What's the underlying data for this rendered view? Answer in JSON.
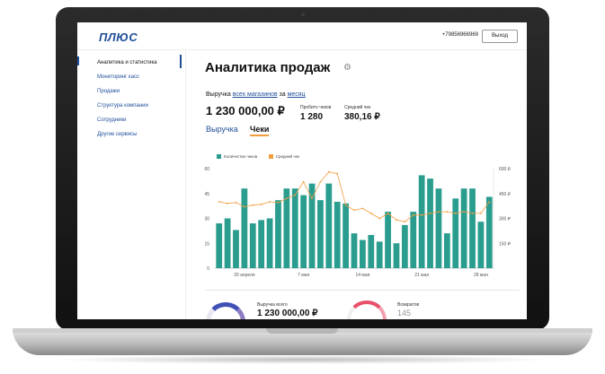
{
  "header": {
    "logo": "ПЛЮС",
    "phone": "+79856966969",
    "logout_label": "Выход"
  },
  "sidebar": {
    "items": [
      {
        "label": "Аналитика и статистика",
        "active": true
      },
      {
        "label": "Мониторинг касс",
        "active": false
      },
      {
        "label": "Продажи",
        "active": false
      },
      {
        "label": "Структура компании",
        "active": false
      },
      {
        "label": "Сотрудники",
        "active": false
      },
      {
        "label": "Другие сервисы",
        "active": false
      }
    ]
  },
  "main": {
    "title": "Аналитика продаж",
    "revenue_prefix": "Выручка",
    "revenue_link1": "всех магазинов",
    "revenue_mid": "за",
    "revenue_link2": "месяц",
    "revenue_total": "1 230 000,00 ₽",
    "stat1_label": "Пробито чеков",
    "stat1_value": "1 280",
    "stat2_label": "Средний чек",
    "stat2_value": "380,16 ₽",
    "tabs": [
      "Выручка",
      "Чеки"
    ],
    "active_tab": "Чеки"
  },
  "chart_data": {
    "type": "bar",
    "series": [
      {
        "name": "Количество чеков",
        "type": "bar",
        "axis": "left",
        "color": "#2a9d8f",
        "values": [
          27,
          30,
          23,
          48,
          27,
          29,
          30,
          41,
          48,
          48,
          44,
          51,
          41,
          51,
          40,
          39,
          21,
          17,
          20,
          16,
          34,
          15,
          26,
          34,
          56,
          54,
          48,
          21,
          42,
          48,
          48,
          28,
          43
        ]
      },
      {
        "name": "Средний чек",
        "type": "line",
        "axis": "right",
        "color": "#f39c3c",
        "values": [
          400,
          390,
          395,
          370,
          380,
          385,
          400,
          395,
          420,
          440,
          520,
          420,
          520,
          580,
          570,
          380,
          350,
          360,
          330,
          300,
          330,
          290,
          280,
          320,
          320,
          330,
          340,
          340,
          330,
          340,
          330,
          330,
          400
        ]
      }
    ],
    "x_tick_labels": [
      "30 апреля",
      "7 мая",
      "14 мая",
      "21 мая",
      "28 мая"
    ],
    "ylim_left": [
      0,
      60
    ],
    "yticks_left": [
      0,
      15,
      30,
      45,
      60
    ],
    "ylim_right": [
      0,
      600
    ],
    "yticks_right": [
      "150 ₽",
      "300 ₽",
      "450 ₽",
      "600 ₽"
    ],
    "legend_position": "top-left",
    "grid": false
  },
  "bottom": {
    "total_label": "Выручка всего",
    "total_value": "1 230 000,00 ₽",
    "returns_label": "Возвратов",
    "returns_value": "145"
  }
}
